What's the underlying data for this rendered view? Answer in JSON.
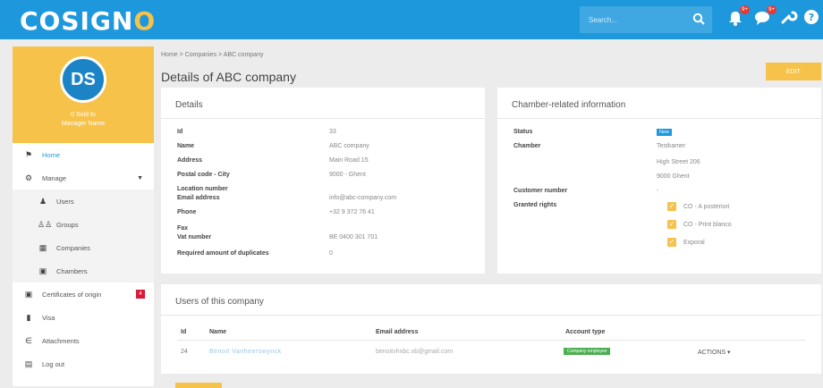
{
  "brand": {
    "name_prefix": "COSIGN",
    "name_suffix": "O"
  },
  "header": {
    "search_placeholder": "Search...",
    "notifications_count": "9+",
    "messages_count": "9+"
  },
  "profile": {
    "initials": "DS",
    "line1": "0 Sold to",
    "line2": "Manager Name"
  },
  "sidebar": {
    "items": [
      {
        "label": "Home",
        "icon": "home-icon"
      },
      {
        "label": "Manage",
        "icon": "gear-icon"
      },
      {
        "label": "Users",
        "icon": "user-icon"
      },
      {
        "label": "Groups",
        "icon": "group-icon"
      },
      {
        "label": "Companies",
        "icon": "building-icon"
      },
      {
        "label": "Chambers",
        "icon": "chamber-icon"
      },
      {
        "label": "Certificates of origin",
        "icon": "certificate-icon",
        "badge": "4"
      },
      {
        "label": "Visa",
        "icon": "document-icon"
      },
      {
        "label": "Attachments",
        "icon": "paperclip-icon"
      },
      {
        "label": "Log out",
        "icon": "logout-icon"
      }
    ]
  },
  "breadcrumb": {
    "home": "Home",
    "sep": ">",
    "companies": "Companies",
    "current": "ABC company"
  },
  "page_title": "Details of ABC company",
  "edit_label": "EDIT",
  "details": {
    "title": "Details",
    "rows": [
      {
        "k": "Id",
        "v": "33"
      },
      {
        "k": "Name",
        "v": "ABC company"
      },
      {
        "k": "Address",
        "v": "Main Road 15"
      },
      {
        "k": "Postal code - City",
        "v": "9000 - Ghent"
      },
      {
        "k": "Location number",
        "v": ""
      },
      {
        "k": "Email address",
        "v": "info@abc-company.com"
      },
      {
        "k": "Phone",
        "v": "+32 9 372 76 41"
      },
      {
        "k": "Fax",
        "v": ""
      },
      {
        "k": "Vat number",
        "v": "BE 0400 301 701"
      },
      {
        "k": "Required amount of duplicates",
        "v": "0"
      }
    ]
  },
  "chamber": {
    "title": "Chamber-related information",
    "status_label": "Status",
    "status_value": "New",
    "chamber_label": "Chamber",
    "chamber_name": "Testkamer",
    "chamber_street": "High Street 206",
    "chamber_city": "9000 Ghent",
    "customer_number_label": "Customer number",
    "customer_number_value": "-",
    "granted_rights_label": "Granted rights",
    "rights": [
      "CO - A posteriori",
      "CO - Print blanco",
      "Exporal"
    ]
  },
  "users": {
    "title": "Users of this company",
    "columns": [
      "Id",
      "Name",
      "Email address",
      "Account type"
    ],
    "rows": [
      {
        "id": "24",
        "name": "Benoit Vanheerswynck",
        "email": "benoitvhnbc.vb@gmail.com",
        "account_type": "Company employee",
        "actions": "ACTIONS ▾"
      }
    ]
  },
  "colors": {
    "brand_blue": "#1e98dc",
    "accent_yellow": "#f6c24a",
    "success_green": "#4caf50",
    "danger_red": "#d91a3a"
  }
}
